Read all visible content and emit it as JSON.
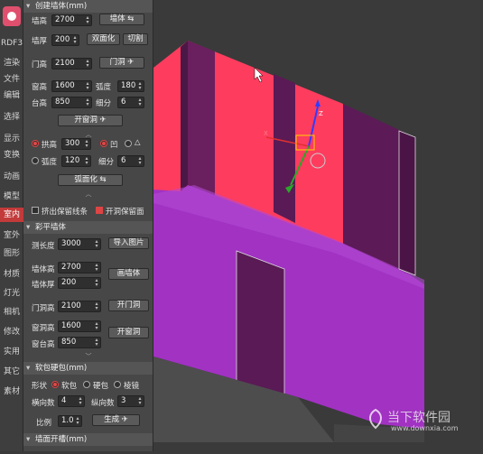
{
  "sidebar": {
    "items": [
      {
        "label": "RDF3"
      },
      {
        "label": "渲染"
      },
      {
        "label": "文件"
      },
      {
        "label": "编辑"
      },
      {
        "label": "选择"
      },
      {
        "label": "显示"
      },
      {
        "label": "变换"
      },
      {
        "label": "动画"
      },
      {
        "label": "模型"
      },
      {
        "label": "室内",
        "active": true
      },
      {
        "label": "室外"
      },
      {
        "label": "图形"
      },
      {
        "label": "材质"
      },
      {
        "label": "灯光"
      },
      {
        "label": "相机"
      },
      {
        "label": "修改"
      },
      {
        "label": "实用"
      },
      {
        "label": "其它"
      },
      {
        "label": "素材"
      }
    ]
  },
  "wall": {
    "title": "创建墙体(mm)",
    "height_label": "墙高",
    "height": "2700",
    "wall_btn": "墙体",
    "thick_label": "墙厚",
    "thick": "200",
    "double_btn": "双面化",
    "cut_btn": "切割",
    "door_h_label": "门高",
    "door_h": "2100",
    "door_btn": "门洞",
    "win_h_label": "窗高",
    "win_h": "1600",
    "arc_label": "弧度",
    "arc": "180",
    "sill_label": "台高",
    "sill": "850",
    "sub_label": "细分",
    "sub": "6",
    "open_win_btn": "开窗洞",
    "arch_label": "拱高",
    "arch": "300",
    "concave": "凹",
    "arc2_label": "弧度",
    "arc2": "120",
    "sub2_label": "细分",
    "sub2": "6",
    "arc_btn": "弧面化",
    "extrude_label": "挤出保留线条",
    "keep_face_label": "开洞保留面"
  },
  "flat_wall": {
    "title": "彩平墙体",
    "measure_label": "测长度",
    "measure": "3000",
    "import_btn": "导入图片",
    "height_label": "墙体高",
    "height": "2700",
    "thick_label": "墙体厚",
    "thick": "200",
    "draw_btn": "画墙体",
    "door_label": "门洞高",
    "door": "2100",
    "door_btn": "开门洞",
    "win_label": "窗洞高",
    "win": "1600",
    "sill_label": "窗台高",
    "sill": "850",
    "win_btn": "开窗洞"
  },
  "soft": {
    "title": "软包硬包(mm)",
    "shape_label": "形状",
    "opt1": "软包",
    "opt2": "硬包",
    "opt3": "棱镜",
    "h_label": "横向数",
    "h": "4",
    "v_label": "纵向数",
    "v": "3",
    "ratio_label": "比例",
    "ratio": "1.0",
    "gen_btn": "生成"
  },
  "groove": {
    "title": "墙面开槽(mm)"
  },
  "watermark": {
    "line1": "当下软件园",
    "line2": "www.downxia.com"
  },
  "colors": {
    "wall_red": "#fe3c5e",
    "wall_dark": "#5a1a55",
    "floor": "#a132c2",
    "accent": "#e04848"
  }
}
